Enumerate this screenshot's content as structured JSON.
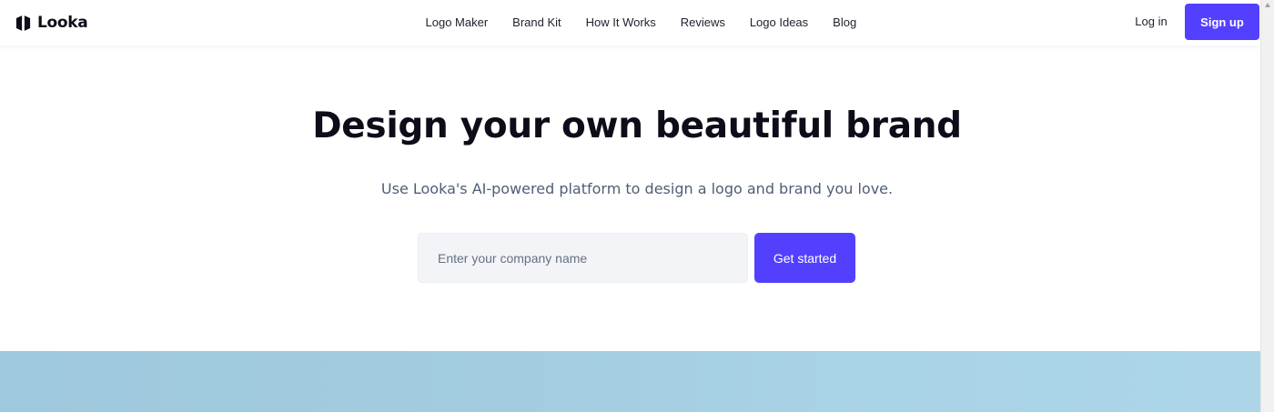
{
  "brand": {
    "name": "Looka",
    "logo_icon": "looka-logo-icon",
    "accent_color": "#5340ff"
  },
  "nav": {
    "links": [
      {
        "label": "Logo Maker"
      },
      {
        "label": "Brand Kit"
      },
      {
        "label": "How It Works"
      },
      {
        "label": "Reviews"
      },
      {
        "label": "Logo Ideas"
      },
      {
        "label": "Blog"
      }
    ],
    "login_label": "Log in",
    "signup_label": "Sign up"
  },
  "hero": {
    "title": "Design your own beautiful brand",
    "subtitle": "Use Looka's AI-powered platform to design a logo and brand you love.",
    "input_placeholder": "Enter your company name",
    "input_value": "",
    "cta_label": "Get started"
  },
  "banner": {
    "color": "#a3cde0"
  }
}
